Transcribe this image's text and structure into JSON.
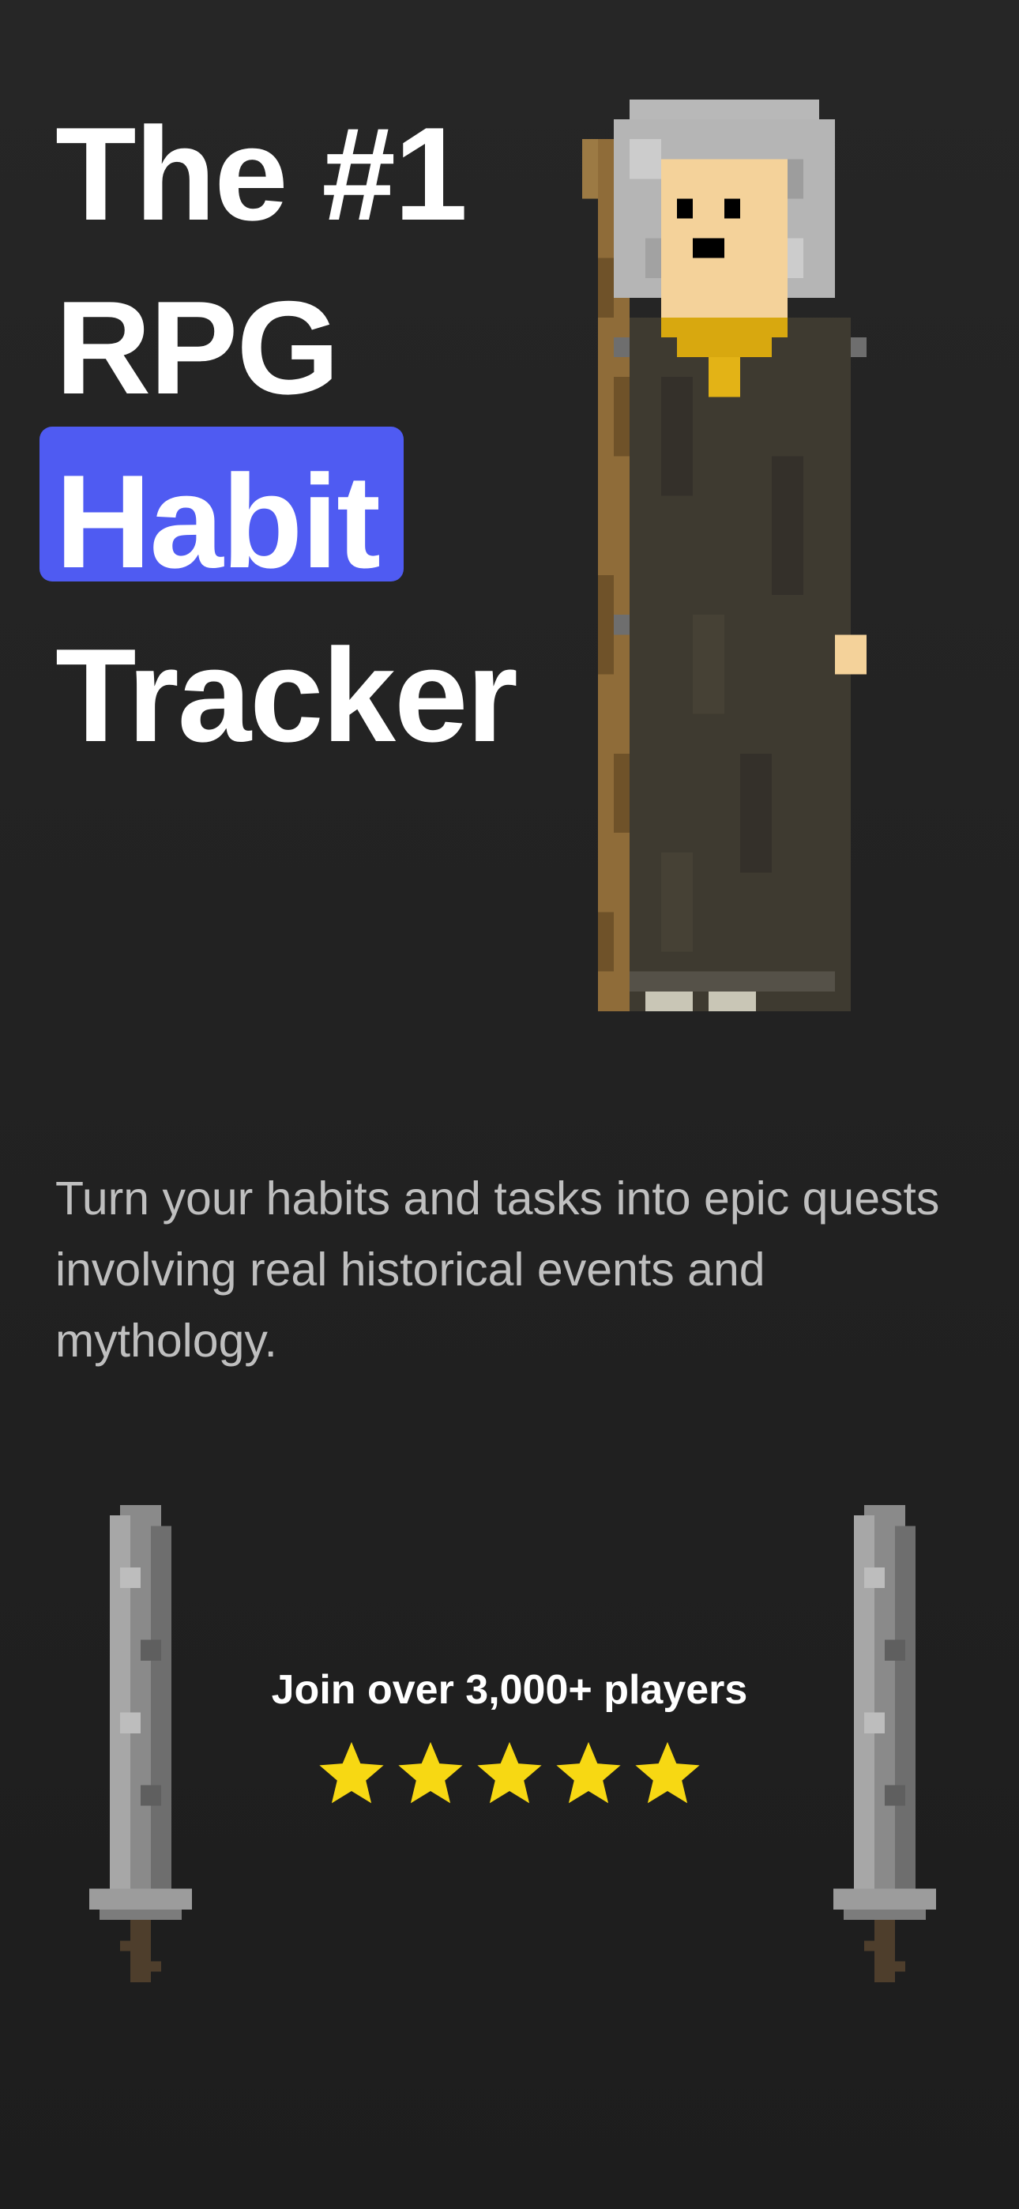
{
  "hero": {
    "line1": "The #1",
    "line2": "RPG",
    "highlight": "Habit",
    "line4": "Tracker",
    "highlight_color": "#4f5bf2"
  },
  "character": {
    "icon": "wizard-character-icon"
  },
  "tagline": "Turn your habits and tasks into epic quests involving real historical events and mythology.",
  "social_proof": {
    "text": "Join over 3,000+ players",
    "rating": 5,
    "star_color": "#f7d813",
    "icons": [
      "sword-icon",
      "star-icon"
    ]
  },
  "colors": {
    "background": "#232323",
    "text_primary": "#ffffff",
    "text_secondary": "#bfbfbf"
  }
}
